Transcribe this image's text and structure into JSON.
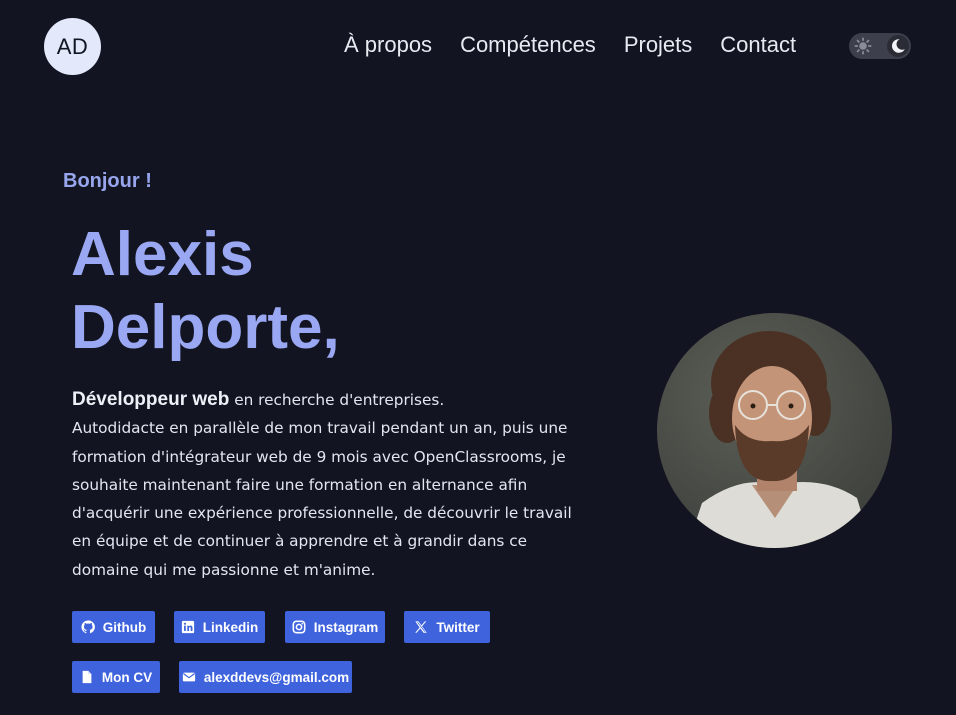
{
  "header": {
    "logo": "AD",
    "nav": [
      "À propos",
      "Compétences",
      "Projets",
      "Contact"
    ],
    "theme_toggle": {
      "state": "dark",
      "icons": [
        "sun-icon",
        "moon-icon"
      ]
    }
  },
  "hero": {
    "greeting": "Bonjour !",
    "name_line1": "Alexis",
    "name_line2": "Delporte,",
    "role": "Développeur web",
    "tagline": " en recherche d'entreprises.",
    "description": "Autodidacte en parallèle de mon travail pendant un an, puis une formation d'intégrateur web de 9 mois avec OpenClassrooms, je souhaite maintenant faire une formation en alternance afin d'acquérir une expérience professionnelle, de découvrir le travail en équipe et de continuer à apprendre et à grandir dans ce domaine qui me passionne et m'anime."
  },
  "links": [
    {
      "label": "Github",
      "icon": "github-icon"
    },
    {
      "label": "Linkedin",
      "icon": "linkedin-icon"
    },
    {
      "label": "Instagram",
      "icon": "instagram-icon"
    },
    {
      "label": "Twitter",
      "icon": "x-twitter-icon"
    },
    {
      "label": "Mon CV",
      "icon": "file-icon"
    },
    {
      "label": "alexddevs@gmail.com",
      "icon": "envelope-icon"
    }
  ],
  "colors": {
    "background": "#121521",
    "accent": "#9aa8f3",
    "button": "#3e63dd"
  }
}
